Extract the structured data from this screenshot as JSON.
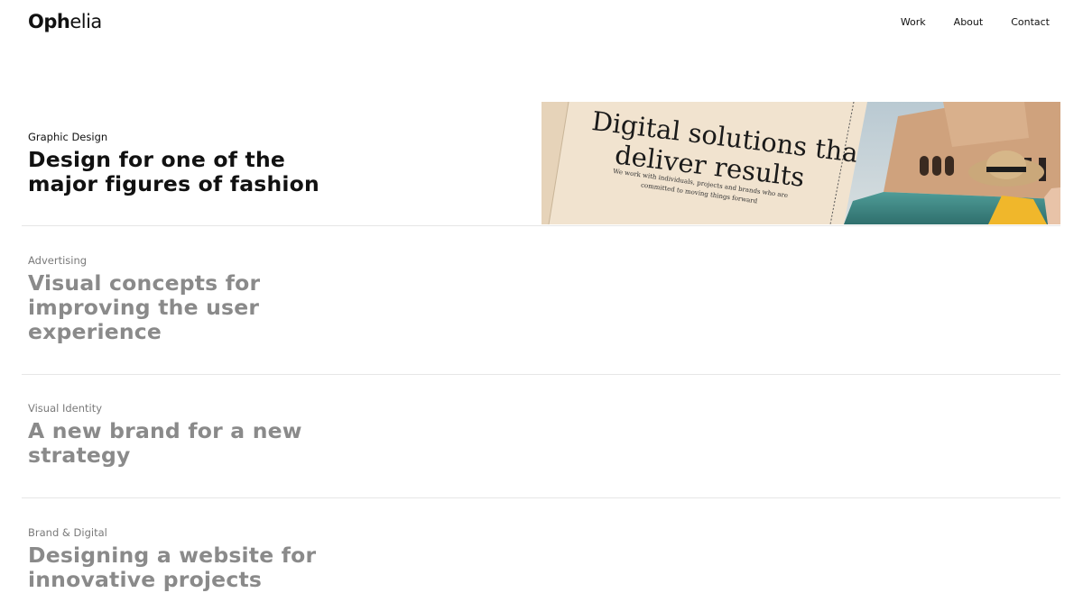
{
  "brand": {
    "logo_bold": "Oph",
    "logo_light": "elia"
  },
  "nav": {
    "items": [
      {
        "label": "Work"
      },
      {
        "label": "About"
      },
      {
        "label": "Contact"
      }
    ]
  },
  "projects": [
    {
      "category": "Graphic Design",
      "title": "Design for one of the major figures of fashion",
      "thumbnail": {
        "headline": "Digital solutions that deliver results",
        "headline_line1": "Digital solutions that",
        "headline_line2": "deliver results",
        "body_line1": "We work with individuals, projects and brands who are",
        "body_line2": "committed to moving things forward"
      }
    },
    {
      "category": "Advertising",
      "title": "Visual concepts for improving the user experience"
    },
    {
      "category": "Visual Identity",
      "title": "A new brand for a new strategy"
    },
    {
      "category": "Brand & Digital",
      "title": "Designing a website for innovative projects"
    }
  ],
  "colors": {
    "text": "#111111",
    "muted_title": "#8a8a8a",
    "muted_category": "#7a7a7a",
    "divider": "#e6e6e6",
    "thumb_bg": "#f1e3cf"
  }
}
